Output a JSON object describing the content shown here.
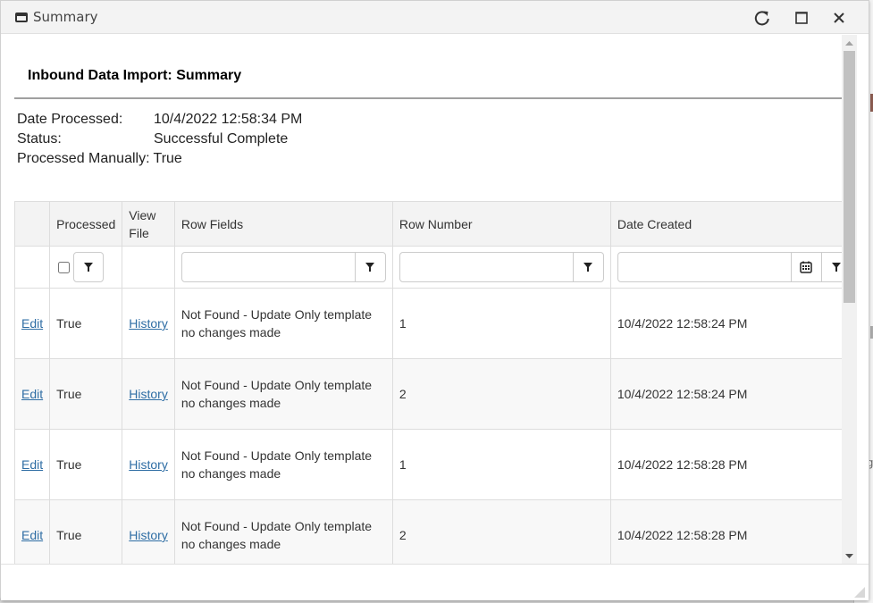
{
  "window": {
    "title": "Summary",
    "icon": "window-icon",
    "controls": {
      "refresh": "refresh-icon",
      "maximize": "maximize-icon",
      "close": "close-icon"
    }
  },
  "page": {
    "title": "Inbound Data Import: Summary",
    "info": [
      {
        "label": "Date Processed:",
        "value": "10/4/2022 12:58:34 PM"
      },
      {
        "label": "Status:",
        "value": "Successful Complete"
      },
      {
        "label": "Processed Manually:",
        "value": "True"
      }
    ]
  },
  "grid": {
    "columns": [
      "",
      "Processed",
      "View File",
      "Row Fields",
      "Row Number",
      "Date Created",
      "",
      ""
    ],
    "filters": {
      "processed_checked": false,
      "row_fields": "",
      "row_number": "",
      "date_created": "",
      "col7": "",
      "col8": ""
    },
    "rows": [
      {
        "action": "Edit",
        "processed": "True",
        "view_file": "History",
        "row_fields": "Not Found - Update Only template no changes made",
        "row_number": "1",
        "date_created": "10/4/2022 12:58:24 PM"
      },
      {
        "action": "Edit",
        "processed": "True",
        "view_file": "History",
        "row_fields": "Not Found - Update Only template no changes made",
        "row_number": "2",
        "date_created": "10/4/2022 12:58:24 PM"
      },
      {
        "action": "Edit",
        "processed": "True",
        "view_file": "History",
        "row_fields": "Not Found - Update Only template no changes made",
        "row_number": "1",
        "date_created": "10/4/2022 12:58:28 PM"
      },
      {
        "action": "Edit",
        "processed": "True",
        "view_file": "History",
        "row_fields": "Not Found - Update Only template no changes made",
        "row_number": "2",
        "date_created": "10/4/2022 12:58:28 PM"
      }
    ]
  },
  "colors": {
    "link": "#2e6da4",
    "header_bg": "#f3f3f3",
    "titlebar_bg": "#f3f3f3",
    "alt_row_bg": "#f8f8f8",
    "scroll_thumb": "#c1c1c1"
  }
}
